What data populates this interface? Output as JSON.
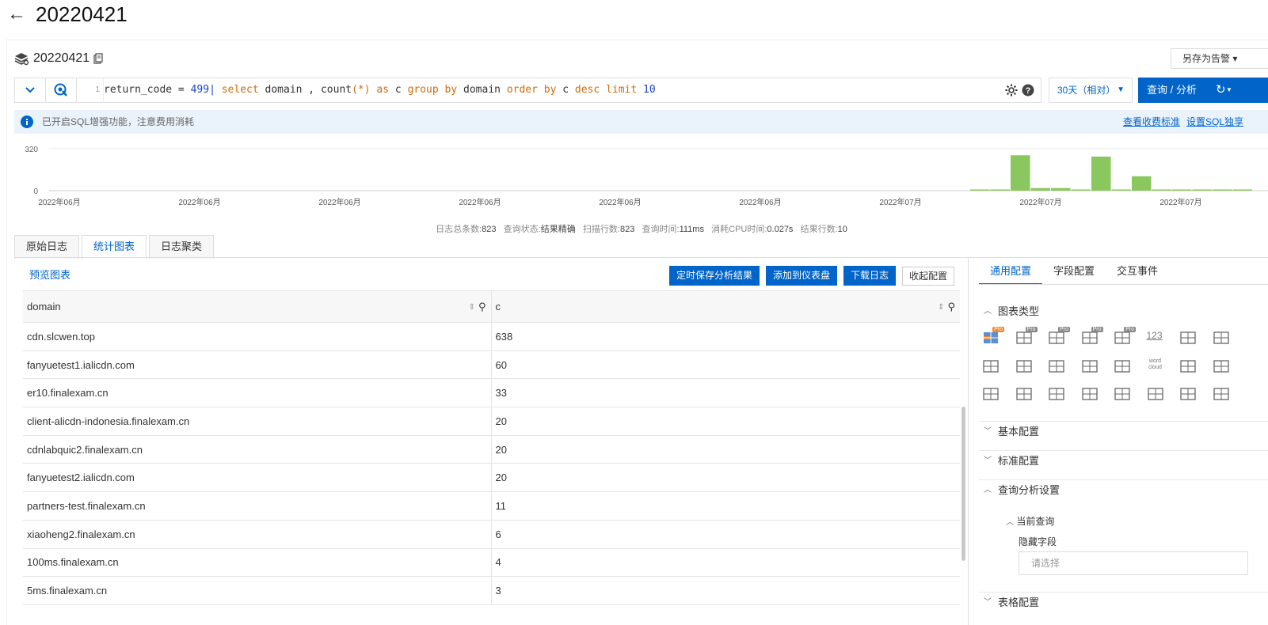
{
  "page": {
    "title": "20220421",
    "back_icon": "arrow-left-icon"
  },
  "logstore": {
    "name": "20220421",
    "save_as_label": "另存为告警"
  },
  "query": {
    "line_no": "1",
    "tokens": [
      {
        "t": "return_code",
        "c": "op"
      },
      {
        "t": " = ",
        "c": "op"
      },
      {
        "t": "499",
        "c": "num"
      },
      {
        "t": "| ",
        "c": "num"
      },
      {
        "t": "select",
        "c": "kw"
      },
      {
        "t": " domain , ",
        "c": "op"
      },
      {
        "t": "count",
        "c": "fn"
      },
      {
        "t": "(*)",
        "c": "kw"
      },
      {
        "t": " ",
        "c": "op"
      },
      {
        "t": "as",
        "c": "kw"
      },
      {
        "t": " c ",
        "c": "op"
      },
      {
        "t": "group by",
        "c": "kw"
      },
      {
        "t": " domain ",
        "c": "op"
      },
      {
        "t": "order by",
        "c": "kw"
      },
      {
        "t": " c ",
        "c": "op"
      },
      {
        "t": "desc",
        "c": "kw"
      },
      {
        "t": " ",
        "c": "op"
      },
      {
        "t": "limit",
        "c": "kw"
      },
      {
        "t": " ",
        "c": "op"
      },
      {
        "t": "10",
        "c": "num"
      }
    ],
    "time_range": "30天（相对）",
    "search_label": "查询 / 分析"
  },
  "notice": {
    "text": "已开启SQL增强功能，注意费用消耗",
    "link1": "查看收费标准",
    "link2": "设置SQL独享"
  },
  "histogram": {
    "ymax_label": "320",
    "ymin_label": "0",
    "x_labels": [
      "2022年06月",
      "2022年06月",
      "2022年06月",
      "2022年06月",
      "2022年06月",
      "2022年06月",
      "2022年07月",
      "2022年07月",
      "2022年07月"
    ],
    "bars": [
      4,
      4,
      270,
      20,
      20,
      4,
      260,
      4,
      110,
      4,
      4,
      4,
      4,
      4
    ],
    "ymax": 320,
    "color": "#8ac75e"
  },
  "stats": {
    "total_label": "日志总条数:",
    "total": "823",
    "state_label": "查询状态:",
    "state": "结果精确",
    "scan_label": "扫描行数:",
    "scan": "823",
    "time_label": "查询时间:",
    "time": "111ms",
    "cpu_label": "消耗CPU时间:",
    "cpu": "0.027s",
    "rows_label": "结果行数:",
    "rows": "10"
  },
  "tabs": [
    "原始日志",
    "统计图表",
    "日志聚类"
  ],
  "left": {
    "preview": "预览图表",
    "btn_schedule": "定时保存分析结果",
    "btn_dashboard": "添加到仪表盘",
    "btn_download": "下载日志",
    "btn_collapse": "收起配置"
  },
  "table": {
    "columns": [
      "domain",
      "c"
    ],
    "rows": [
      [
        "cdn.slcwen.top",
        "638"
      ],
      [
        "fanyuetest1.ialicdn.com",
        "60"
      ],
      [
        "er10.finalexam.cn",
        "33"
      ],
      [
        "client-alicdn-indonesia.finalexam.cn",
        "20"
      ],
      [
        "cdnlabquic2.finalexam.cn",
        "20"
      ],
      [
        "fanyuetest2.ialicdn.com",
        "20"
      ],
      [
        "partners-test.finalexam.cn",
        "11"
      ],
      [
        "xiaoheng2.finalexam.cn",
        "6"
      ],
      [
        "100ms.finalexam.cn",
        "4"
      ],
      [
        "5ms.finalexam.cn",
        "3"
      ]
    ]
  },
  "right": {
    "tabs": [
      "通用配置",
      "字段配置",
      "交互事件"
    ],
    "sec_chart_type": "图表类型",
    "sec_basic": "基本配置",
    "sec_standard": "标准配置",
    "sec_query": "查询分析设置",
    "current_query": "当前查询",
    "hidden_field": "隐藏字段",
    "select_placeholder": "请选择",
    "sec_table": "表格配置",
    "chart_icons": [
      "table-chart-icon",
      "line-chart-icon",
      "bar-chart-icon",
      "area-chart-icon",
      "pie-chart-icon",
      "single-value-icon",
      "progress-bar-icon",
      "flow-chart-icon",
      "map-icon",
      "world-map-icon",
      "amap-icon",
      "topology-icon",
      "sankey-icon",
      "word-cloud-icon",
      "treemap-icon",
      "funnel-icon",
      "histogram-icon",
      "column-chart-icon",
      "heatmap-icon",
      "tree-icon",
      "china-map-icon",
      "location-icon",
      "scatter-icon",
      "boxplot-icon"
    ],
    "icon_numeric_text": "123",
    "icon_wordcloud_text": "word cloud",
    "pro_label": "Pro"
  }
}
